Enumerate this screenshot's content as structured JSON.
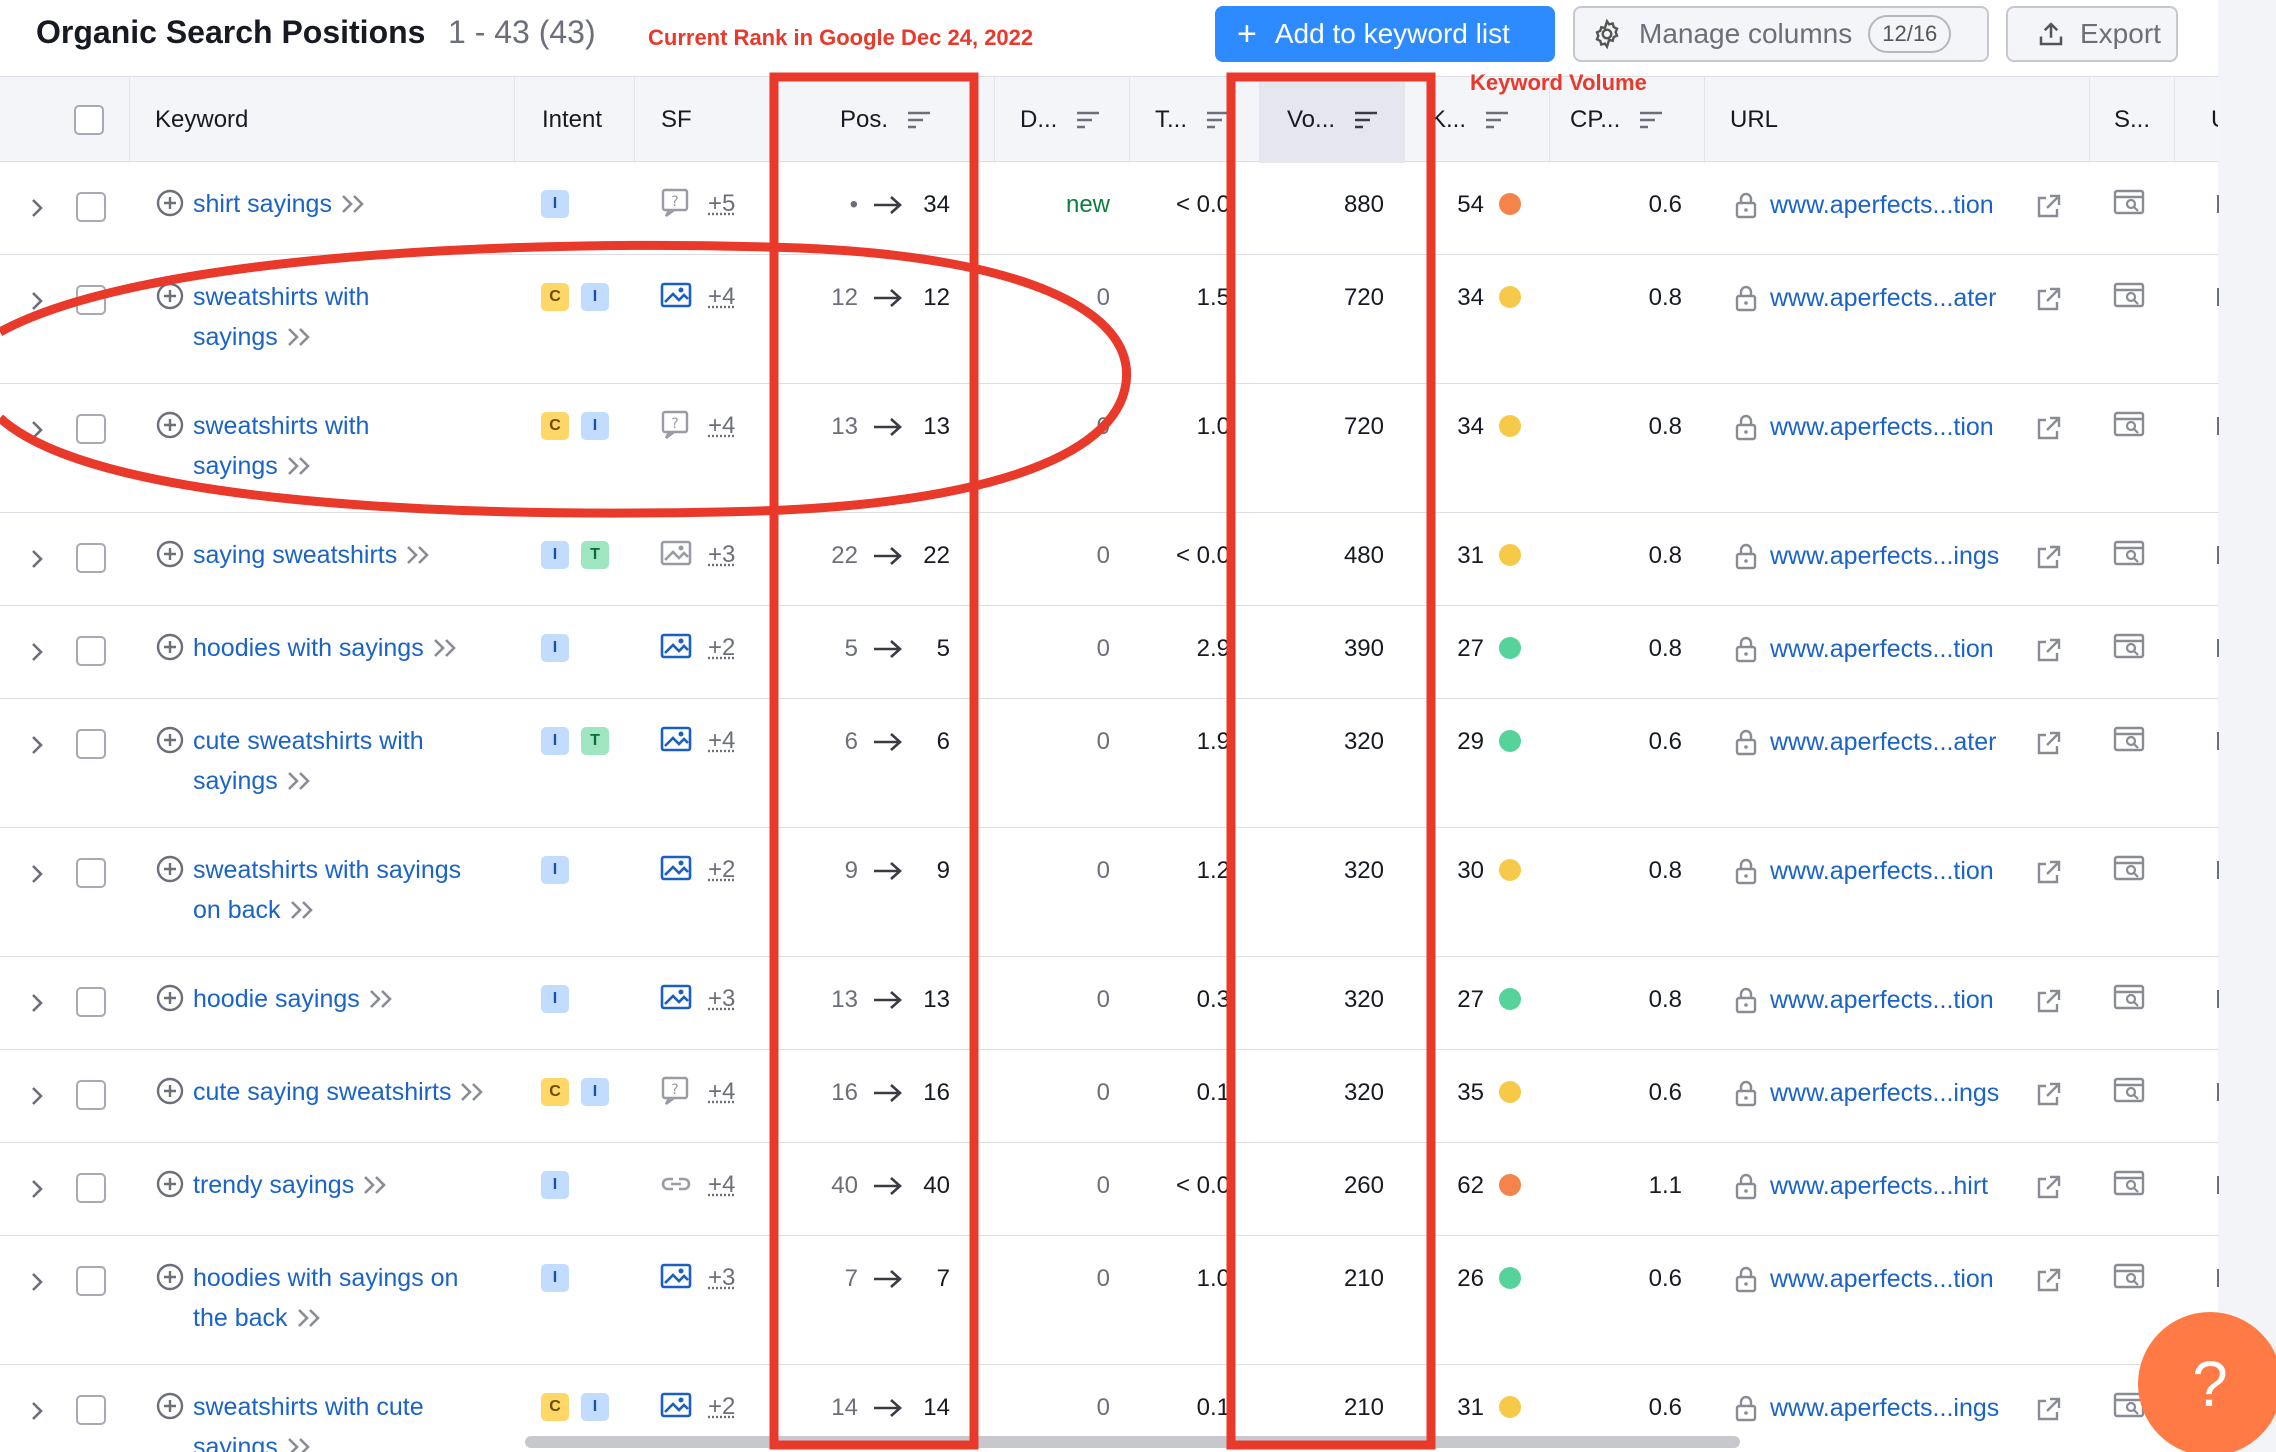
{
  "header": {
    "title": "Organic Search Positions",
    "count": "1 - 43 (43)",
    "annotation_rank": "Current Rank in Google Dec 24, 2022",
    "annotation_volume": "Keyword Volume",
    "add_button": "Add to keyword list",
    "manage_columns": "Manage columns",
    "columns_pill": "12/16",
    "export": "Export"
  },
  "columns": {
    "keyword": "Keyword",
    "intent": "Intent",
    "sf": "SF",
    "pos": "Pos.",
    "diff": "D...",
    "traffic": "T...",
    "volume": "Vo...",
    "kd": "K...",
    "cpc": "CP...",
    "url": "URL",
    "serp": "S...",
    "last": "U"
  },
  "colors": {
    "accent": "#2e8bff",
    "link": "#1a63c9",
    "annotation": "#e8392b",
    "kd_orange": "#f4844c",
    "kd_yellow": "#f7c948",
    "kd_green": "#56d39a",
    "help_button": "#ff7a45"
  },
  "rows": [
    {
      "kw1": "shirt sayings",
      "kw2": "",
      "intent": [
        "I"
      ],
      "sf_icon": "question-sf-icon",
      "sf_more": "+5",
      "pos_prev": "•",
      "pos": "34",
      "diff": "new",
      "traffic": "< 0.0",
      "volume": "880",
      "kd": "54",
      "kd_color": "#f4844c",
      "cpc": "0.6",
      "url": "www.aperfects...tion"
    },
    {
      "kw1": "sweatshirts with",
      "kw2": "sayings",
      "intent": [
        "C",
        "I"
      ],
      "sf_icon": "image-sf-icon",
      "sf_more": "+4",
      "pos_prev": "12",
      "pos": "12",
      "diff": "0",
      "traffic": "1.5",
      "volume": "720",
      "kd": "34",
      "kd_color": "#f7c948",
      "cpc": "0.8",
      "url": "www.aperfects...ater"
    },
    {
      "kw1": "sweatshirts with",
      "kw2": "sayings",
      "intent": [
        "C",
        "I"
      ],
      "sf_icon": "question-sf-icon",
      "sf_more": "+4",
      "pos_prev": "13",
      "pos": "13",
      "diff": "0",
      "traffic": "1.0",
      "volume": "720",
      "kd": "34",
      "kd_color": "#f7c948",
      "cpc": "0.8",
      "url": "www.aperfects...tion"
    },
    {
      "kw1": "saying sweatshirts",
      "kw2": "",
      "intent": [
        "I",
        "T"
      ],
      "sf_icon": "image-sf-icon-grey",
      "sf_more": "+3",
      "pos_prev": "22",
      "pos": "22",
      "diff": "0",
      "traffic": "< 0.0",
      "volume": "480",
      "kd": "31",
      "kd_color": "#f7c948",
      "cpc": "0.8",
      "url": "www.aperfects...ings"
    },
    {
      "kw1": "hoodies with sayings",
      "kw2": "",
      "intent": [
        "I"
      ],
      "sf_icon": "image-sf-icon",
      "sf_more": "+2",
      "pos_prev": "5",
      "pos": "5",
      "diff": "0",
      "traffic": "2.9",
      "volume": "390",
      "kd": "27",
      "kd_color": "#56d39a",
      "cpc": "0.8",
      "url": "www.aperfects...tion"
    },
    {
      "kw1": "cute sweatshirts with",
      "kw2": "sayings",
      "intent": [
        "I",
        "T"
      ],
      "sf_icon": "image-sf-icon",
      "sf_more": "+4",
      "pos_prev": "6",
      "pos": "6",
      "diff": "0",
      "traffic": "1.9",
      "volume": "320",
      "kd": "29",
      "kd_color": "#56d39a",
      "cpc": "0.6",
      "url": "www.aperfects...ater"
    },
    {
      "kw1": "sweatshirts with sayings",
      "kw2": "on back",
      "intent": [
        "I"
      ],
      "sf_icon": "image-sf-icon",
      "sf_more": "+2",
      "pos_prev": "9",
      "pos": "9",
      "diff": "0",
      "traffic": "1.2",
      "volume": "320",
      "kd": "30",
      "kd_color": "#f7c948",
      "cpc": "0.8",
      "url": "www.aperfects...tion"
    },
    {
      "kw1": "hoodie sayings",
      "kw2": "",
      "intent": [
        "I"
      ],
      "sf_icon": "image-sf-icon",
      "sf_more": "+3",
      "pos_prev": "13",
      "pos": "13",
      "diff": "0",
      "traffic": "0.3",
      "volume": "320",
      "kd": "27",
      "kd_color": "#56d39a",
      "cpc": "0.8",
      "url": "www.aperfects...tion"
    },
    {
      "kw1": "cute saying sweatshirts",
      "kw2": "",
      "intent": [
        "C",
        "I"
      ],
      "sf_icon": "question-sf-icon",
      "sf_more": "+4",
      "pos_prev": "16",
      "pos": "16",
      "diff": "0",
      "traffic": "0.1",
      "volume": "320",
      "kd": "35",
      "kd_color": "#f7c948",
      "cpc": "0.6",
      "url": "www.aperfects...ings"
    },
    {
      "kw1": "trendy sayings",
      "kw2": "",
      "intent": [
        "I"
      ],
      "sf_icon": "link-sf-icon",
      "sf_more": "+4",
      "pos_prev": "40",
      "pos": "40",
      "diff": "0",
      "traffic": "< 0.0",
      "volume": "260",
      "kd": "62",
      "kd_color": "#f4844c",
      "cpc": "1.1",
      "url": "www.aperfects...hirt"
    },
    {
      "kw1": "hoodies with sayings on",
      "kw2": "the back",
      "intent": [
        "I"
      ],
      "sf_icon": "image-sf-icon",
      "sf_more": "+3",
      "pos_prev": "7",
      "pos": "7",
      "diff": "0",
      "traffic": "1.0",
      "volume": "210",
      "kd": "26",
      "kd_color": "#56d39a",
      "cpc": "0.6",
      "url": "www.aperfects...tion"
    },
    {
      "kw1": "sweatshirts with cute",
      "kw2": "sayings",
      "intent": [
        "C",
        "I"
      ],
      "sf_icon": "image-sf-icon",
      "sf_more": "+2",
      "pos_prev": "14",
      "pos": "14",
      "diff": "0",
      "traffic": "0.1",
      "volume": "210",
      "kd": "31",
      "kd_color": "#f7c948",
      "cpc": "0.6",
      "url": "www.aperfects...ings"
    }
  ],
  "help": "?"
}
